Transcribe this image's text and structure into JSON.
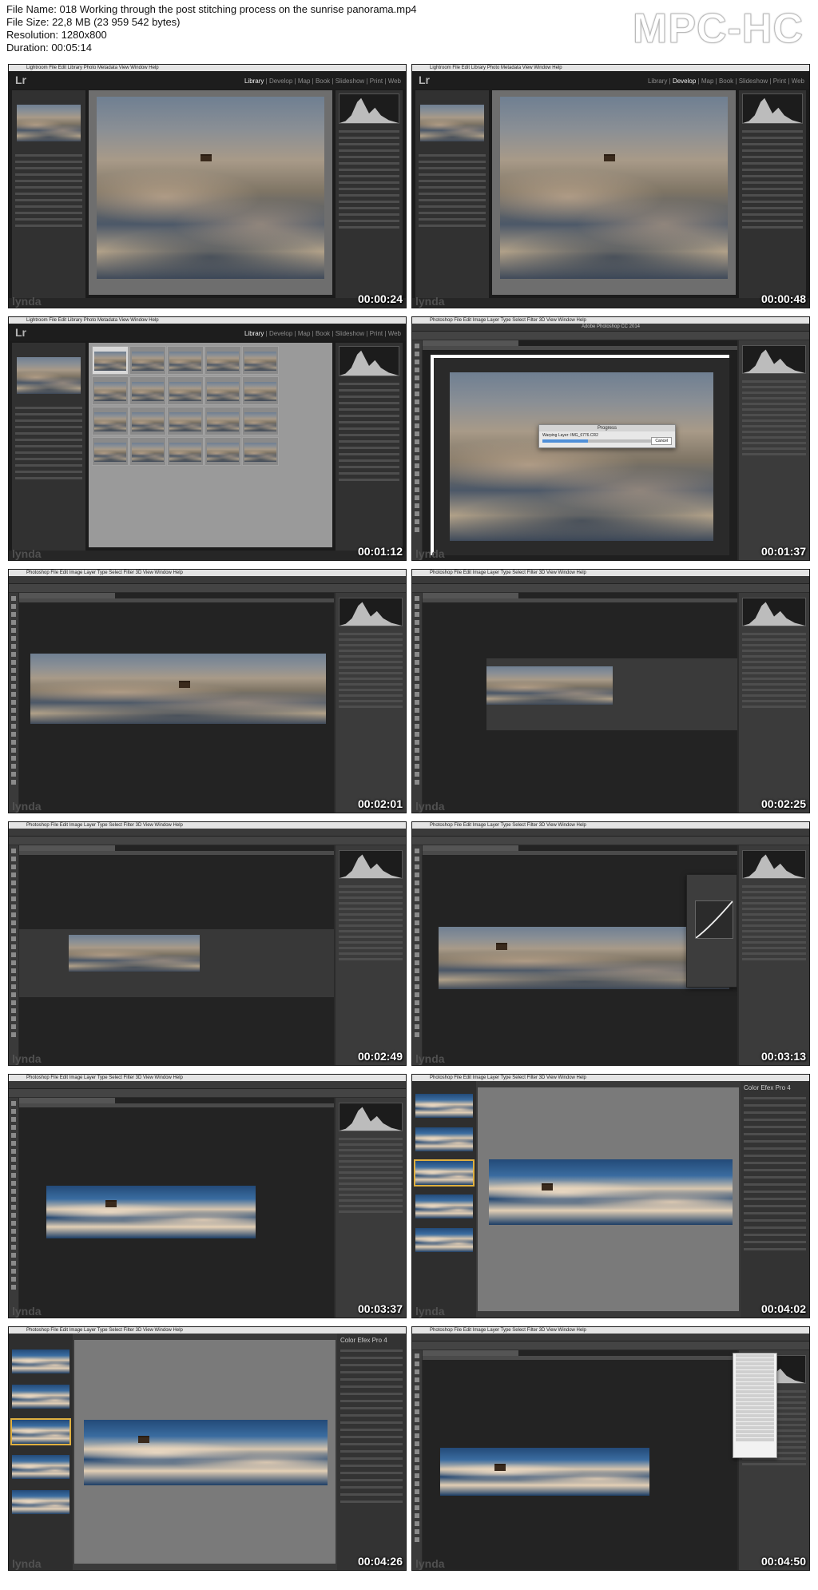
{
  "header": {
    "file_name": "File Name: 018 Working through the post stitching process on the sunrise panorama.mp4",
    "file_size": "File Size: 22,8 MB (23 959 542 bytes)",
    "resolution": "Resolution: 1280x800",
    "duration": "Duration: 00:05:14",
    "brand": "MPC-HC"
  },
  "colors": {
    "lr_bg": "#1d1d1d",
    "ps_bg": "#232323",
    "progress": "#4f8fd8",
    "timestamp": "#ffffff"
  },
  "common": {
    "watermark": "lynda",
    "lr_logo": "Lr",
    "cep_title": "Color Efex Pro 4",
    "menu_lr": "Lightroom  File  Edit  Library  Photo  Metadata  View  Window  Help",
    "menu_ps": "Photoshop  File  Edit  Image  Layer  Type  Select  Filter  3D  View  Window  Help",
    "lr_modules": [
      "Library",
      "Develop",
      "Map",
      "Book",
      "Slideshow",
      "Print",
      "Web"
    ]
  },
  "thumbnails": [
    {
      "app": "lightroom",
      "timestamp": "00:00:24",
      "active_module": "Library"
    },
    {
      "app": "lightroom",
      "timestamp": "00:00:48",
      "active_module": "Develop"
    },
    {
      "app": "lightroom-grid",
      "timestamp": "00:01:12",
      "active_module": "Library"
    },
    {
      "app": "photoshop-progress",
      "timestamp": "00:01:37",
      "title": "Adobe Photoshop CC 2014",
      "dialog_title": "Progress",
      "dialog_text": "Warping Layer: IMG_6776.CR2",
      "dialog_button": "Cancel",
      "progress": 0.35
    },
    {
      "app": "photoshop-wide",
      "timestamp": "00:02:01"
    },
    {
      "app": "photoshop-crop",
      "timestamp": "00:02:25"
    },
    {
      "app": "photoshop-crop2",
      "timestamp": "00:02:49"
    },
    {
      "app": "photoshop-curves",
      "timestamp": "00:03:13"
    },
    {
      "app": "photoshop-vivid",
      "timestamp": "00:03:37"
    },
    {
      "app": "colorefex",
      "timestamp": "00:04:02"
    },
    {
      "app": "colorefex2",
      "timestamp": "00:04:26"
    },
    {
      "app": "photoshop-menu",
      "timestamp": "00:04:50"
    }
  ]
}
